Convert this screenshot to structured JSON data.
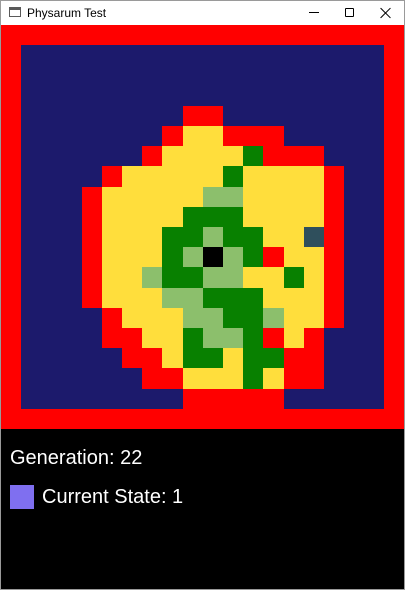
{
  "window": {
    "title": "Physarum Test",
    "icon": "window-app-icon",
    "controls": [
      "minimize-icon",
      "maximize-icon",
      "close-icon"
    ]
  },
  "colors": {
    "border": "#ff0000",
    "background": "#1c1a6c",
    "state_1": "#7f6ff0",
    "yellow": "#ffde3c",
    "light_green": "#8cbf6c",
    "dark_green": "#088000",
    "black": "#000000",
    "teal": "#2f4f5c"
  },
  "grid": {
    "cols": 18,
    "rows": 18,
    "legend": {
      ".": "background",
      "R": "border",
      "Y": "yellow",
      "G": "dark_green",
      "L": "light_green",
      "K": "black",
      "T": "teal",
      "P": "state_1"
    },
    "cells": [
      "..................",
      "..................",
      "..................",
      "..................",
      "........RR........",
      ".......RYYRRR.....",
      "......RYYYYGRRR...",
      "....RYYYYYGYYYYR..",
      "...RYYYYYLLYYYYR..",
      "...RYYYYGGGYYYYR..",
      "...RYYYGGLGGYYTR..",
      "...RYYYGLKLGRYYR..",
      "...RYYLGGLLYYGYR..",
      "...RYYYLLGGGYYYR..",
      "....RYYYLLGGLYYR..",
      "....RRYYGLLGRYR...",
      ".....RRYGGYGGRR...",
      "......RRYYYGYRR...",
      "........RRRRR.....",
      "..................",
      "..................",
      "..........P......."
    ]
  },
  "status": {
    "generation_text": "Generation: 22",
    "state_text": "Current State: 1",
    "state_color": "#7f6ff0"
  }
}
